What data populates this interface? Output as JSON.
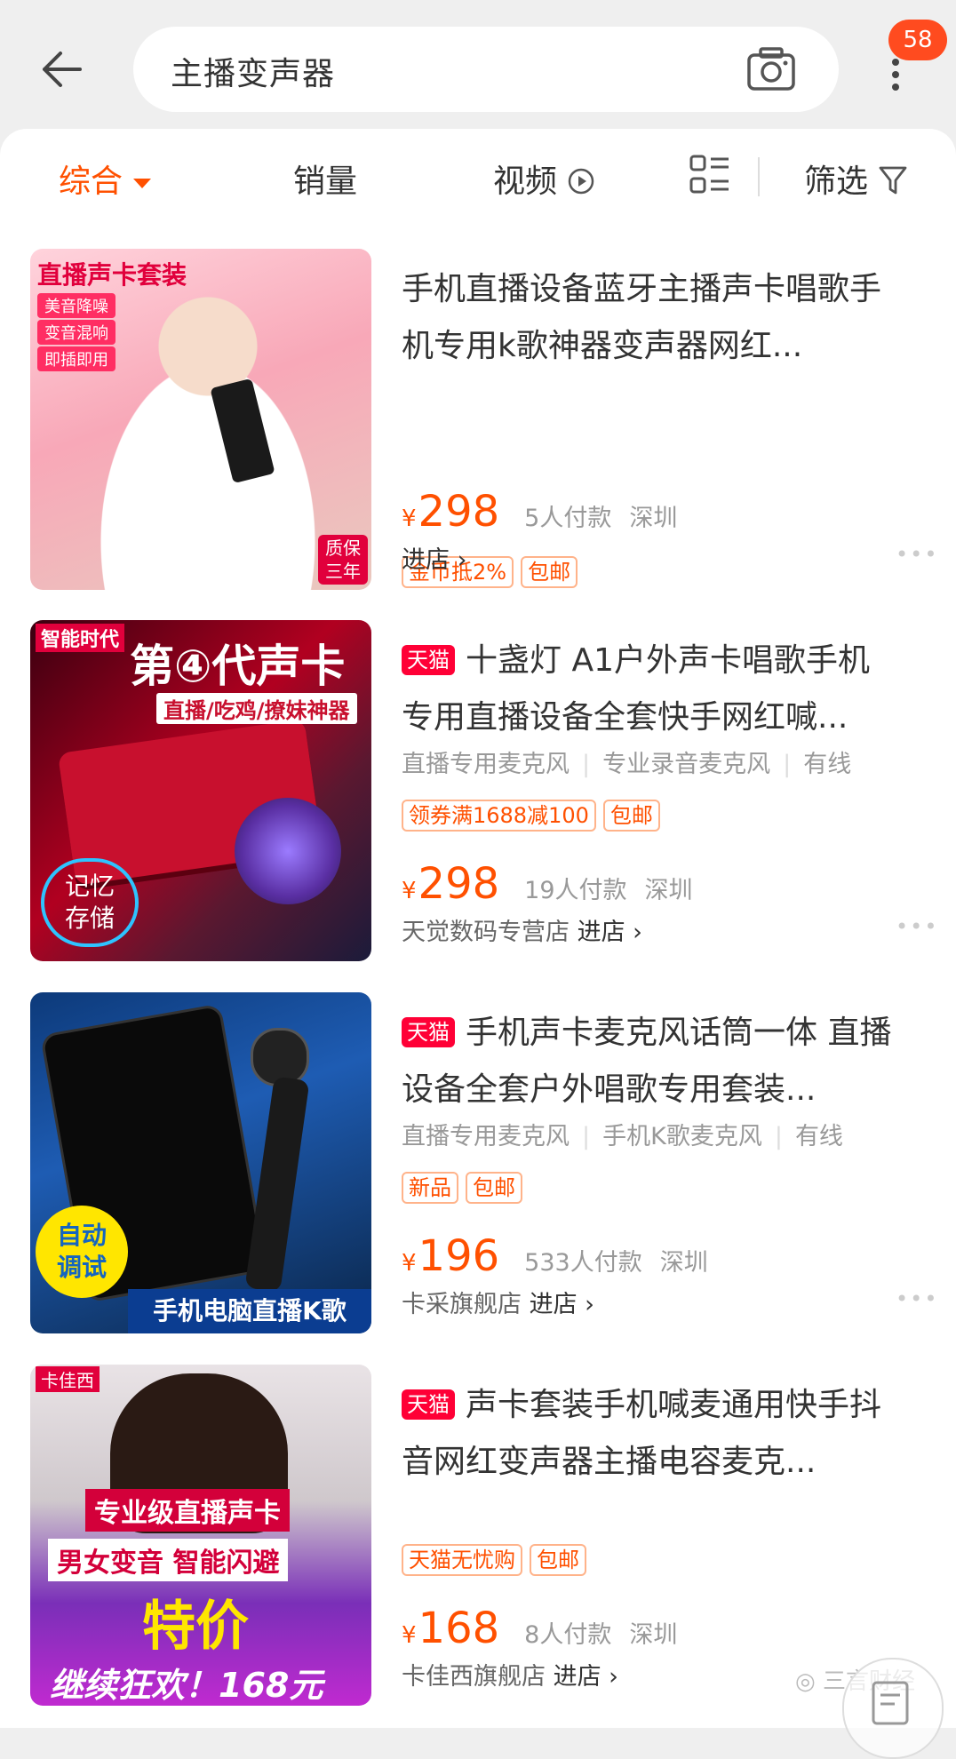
{
  "header": {
    "search_query": "主播变声器",
    "notification_count": "58"
  },
  "sort_bar": {
    "comprehensive": "综合",
    "sales": "销量",
    "video": "视频",
    "filter": "筛选"
  },
  "products": [
    {
      "thumb": {
        "banner": "直播声卡套装",
        "tags": [
          "美音降噪",
          "变音混响",
          "即插即用"
        ],
        "corner": [
          "质保",
          "三年"
        ]
      },
      "title": "手机直播设备蓝牙主播声卡唱歌手机专用k歌神器变声器网红...",
      "tmall": "",
      "props": [],
      "tags": [
        "金币抵2%",
        "包邮"
      ],
      "currency": "¥",
      "price": "298",
      "sales": "5人付款",
      "location": "深圳",
      "shop": "",
      "enter_shop": "进店"
    },
    {
      "thumb": {
        "banner": "智能时代",
        "headline": "第④代声卡",
        "sub": "直播/吃鸡/撩妹神器",
        "badge": [
          "记忆",
          "存储"
        ]
      },
      "title": "十盏灯 A1户外声卡唱歌手机专用直播设备全套快手网红喊...",
      "tmall": "天猫",
      "props": [
        "直播专用麦克风",
        "专业录音麦克风",
        "有线"
      ],
      "tags": [
        "领券满1688减100",
        "包邮"
      ],
      "currency": "¥",
      "price": "298",
      "sales": "19人付款",
      "location": "深圳",
      "shop": "天觉数码专营店",
      "enter_shop": "进店"
    },
    {
      "thumb": {
        "badge": [
          "自动",
          "调试"
        ],
        "footer": "手机电脑直播K歌"
      },
      "title": "手机声卡麦克风话筒一体 直播设备全套户外唱歌专用套装...",
      "tmall": "天猫",
      "props": [
        "直播专用麦克风",
        "手机K歌麦克风",
        "有线"
      ],
      "tags": [
        "新品",
        "包邮"
      ],
      "currency": "¥",
      "price": "196",
      "sales": "533人付款",
      "location": "深圳",
      "shop": "卡采旗舰店",
      "enter_shop": "进店"
    },
    {
      "thumb": {
        "banner": "卡佳西",
        "line1": "专业级直播声卡",
        "line2": "男女变音 智能闪避",
        "line3": "特价",
        "line4": "继续狂欢！168元"
      },
      "title": "声卡套装手机喊麦通用快手抖音网红变声器主播电容麦克...",
      "tmall": "天猫",
      "props": [],
      "tags": [
        "天猫无忧购",
        "包邮"
      ],
      "currency": "¥",
      "price": "168",
      "sales": "8人付款",
      "location": "深圳",
      "shop": "卡佳西旗舰店",
      "enter_shop": "进店"
    }
  ],
  "watermark": "三言财经",
  "colors": {
    "accent": "#ff5000",
    "tmall": "#ff0036",
    "badge": "#ff4b1f"
  }
}
